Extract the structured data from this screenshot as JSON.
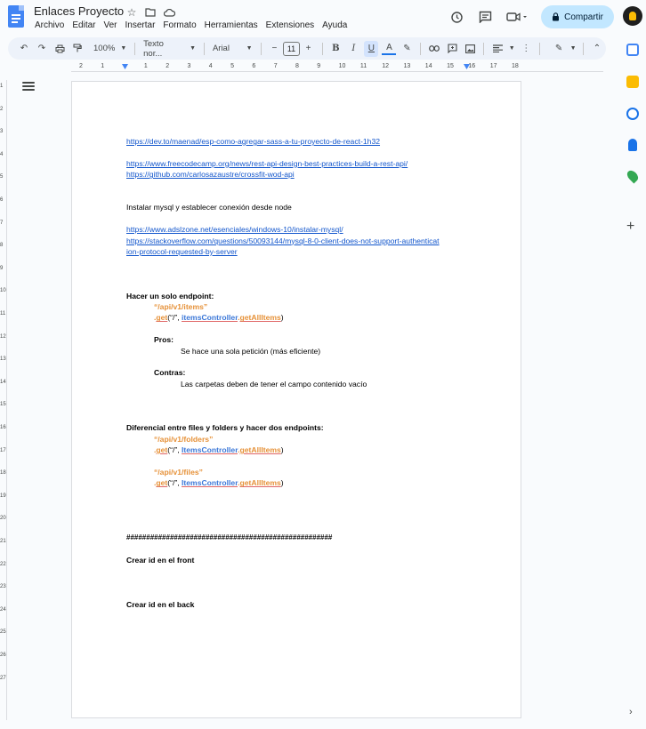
{
  "app": {
    "title": "Enlaces Proyecto",
    "menu": [
      "Archivo",
      "Editar",
      "Ver",
      "Insertar",
      "Formato",
      "Herramientas",
      "Extensiones",
      "Ayuda"
    ],
    "share_label": "Compartir"
  },
  "toolbar": {
    "zoom": "100%",
    "style": "Texto nor...",
    "font": "Arial",
    "font_size": "11",
    "minus": "−",
    "plus": "+",
    "bold": "B",
    "italic": "I",
    "underline": "U",
    "text_color": "A"
  },
  "ruler": {
    "h_ticks": [
      "2",
      "1",
      "",
      "1",
      "2",
      "3",
      "4",
      "5",
      "6",
      "7",
      "8",
      "9",
      "10",
      "11",
      "12",
      "13",
      "14",
      "15",
      "16",
      "17",
      "18"
    ],
    "v_ticks": [
      "1",
      "2",
      "3",
      "4",
      "5",
      "6",
      "7",
      "8",
      "9",
      "10",
      "11",
      "12",
      "13",
      "14",
      "15",
      "16",
      "17",
      "18",
      "19",
      "20",
      "21",
      "22",
      "23",
      "24",
      "25",
      "26",
      "27"
    ]
  },
  "doc": {
    "link1": "https://dev.to/maenad/esp-como-agregar-sass-a-tu-proyecto-de-react-1h32",
    "link2": "https://www.freecodecamp.org/news/rest-api-design-best-practices-build-a-rest-api/",
    "link3": "https://github.com/carlosazaustre/crossfit-wod-api",
    "mysql_text": "Instalar mysql y establecer conexión desde node",
    "link4": "https://www.adslzone.net/esenciales/windows-10/instalar-mysql/",
    "link5a": "https://stackoverflow.com/questions/50093144/mysql-8-0-client-does-not-support-authenticat",
    "link5b": "ion-protocol-requested-by-server",
    "h1": "Hacer un solo endpoint:",
    "route_items": "“/api/v1/items”",
    "get": "get",
    "dot": ".",
    "args_open": "(“/”, ",
    "controller": "itemsController",
    "method": "getAllItems",
    "args_close": ")",
    "pros_label": "Pros:",
    "pros_text": "Se hace una sola petición (más eficiente)",
    "contras_label": "Contras:",
    "contras_text": "Las carpetas deben de tener el campo contenido vacío",
    "h2": "Diferencial entre files y folders y hacer dos endpoints:",
    "route_folders": "“/api/v1/folders”",
    "route_files": "“/api/v1/files”",
    "controller2": "ItemsController",
    "hashes": "####################################################",
    "front": "Crear id en el front",
    "back": "Crear id en el back"
  }
}
